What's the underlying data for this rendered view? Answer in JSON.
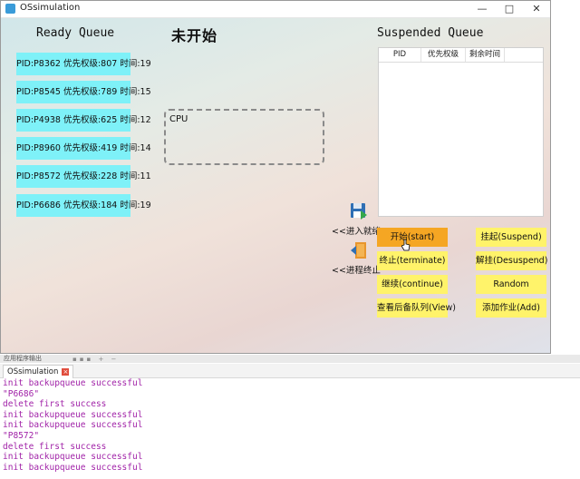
{
  "window": {
    "title": "OSsimulation"
  },
  "headings": {
    "ready": "Ready Queue",
    "status": "未开始",
    "suspended": "Suspended Queue"
  },
  "ready_queue": [
    "PID:P8362 优先权级:807 时间:19",
    "PID:P8545 优先权级:789 时间:15",
    "PID:P4938 优先权级:625 时间:12",
    "PID:P8960 优先权级:419 时间:14",
    "PID:P8572 优先权级:228 时间:11",
    "PID:P6686 优先权级:184 时间:19"
  ],
  "cpu": {
    "label": "CPU"
  },
  "suspended_table": {
    "columns": [
      "PID",
      "优先权级",
      "剩余时间"
    ]
  },
  "actions": {
    "enter_ready": "<<进入就绪",
    "terminate_process": "<<进程终止"
  },
  "buttons": {
    "start": "开始(start)",
    "suspend": "挂起(Suspend)",
    "terminate": "终止(terminate)",
    "desuspend": "解挂(Desuspend)",
    "continue": "继续(continue)",
    "random": "Random",
    "view": "查看后备队列(View)",
    "add": "添加作业(Add)"
  },
  "output_panel": {
    "title": "应用程序输出",
    "tab": "OSsimulation",
    "lines": [
      "init backupqueue successful",
      "\"P6686\"",
      "delete first success",
      "init backupqueue successful",
      "init backupqueue successful",
      "\"P8572\"",
      "delete first success",
      "init backupqueue successful",
      "init backupqueue successful"
    ]
  },
  "colors": {
    "ready_item": "#7ef1f8",
    "button": "#fff36a",
    "button_active": "#f5a623",
    "output_text": "#a123a8"
  }
}
